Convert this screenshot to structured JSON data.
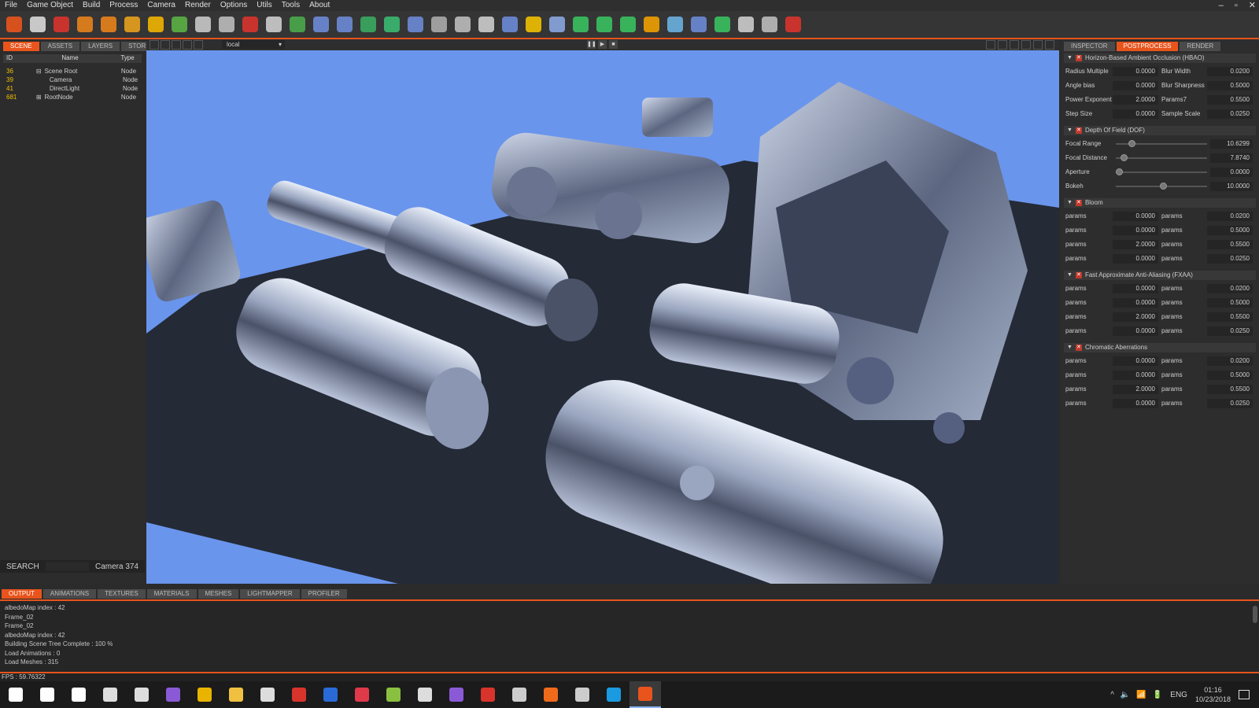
{
  "menu": [
    "File",
    "Game Object",
    "Build",
    "Process",
    "Camera",
    "Render",
    "Options",
    "Utils",
    "Tools",
    "About"
  ],
  "window_controls": [
    "–",
    "▫",
    "✕"
  ],
  "toolbar_icons": [
    {
      "name": "character-icon",
      "color": "#e8541c"
    },
    {
      "name": "trooper-helmet-icon",
      "color": "#d8d8d8"
    },
    {
      "name": "trash-icon",
      "color": "#d8342c"
    },
    {
      "name": "box-icon",
      "color": "#e8821c"
    },
    {
      "name": "rotate-icon",
      "color": "#e8821c"
    },
    {
      "name": "move-icon",
      "color": "#e8a01c"
    },
    {
      "name": "gamepad-icon",
      "color": "#f0b400"
    },
    {
      "name": "terrain-icon",
      "color": "#5ab044"
    },
    {
      "name": "particles-icon",
      "color": "#c8c8c8"
    },
    {
      "name": "cube-gray-icon",
      "color": "#bbbbbb"
    },
    {
      "name": "octopus-icon",
      "color": "#d8342c"
    },
    {
      "name": "igs-text-icon",
      "color": "#cccccc"
    },
    {
      "name": "igs-map-icon",
      "color": "#4aa84a"
    },
    {
      "name": "leaf-icon",
      "color": "#6b8ad6"
    },
    {
      "name": "cube-blue-icon",
      "color": "#6b8ad6"
    },
    {
      "name": "map-green-icon",
      "color": "#3aa860"
    },
    {
      "name": "sphere-icon",
      "color": "#3ab870"
    },
    {
      "name": "arrow-up-icon",
      "color": "#6b8ad6"
    },
    {
      "name": "grid-cube-icon",
      "color": "#aaaaaa"
    },
    {
      "name": "dots-grid-icon",
      "color": "#bbbbbb"
    },
    {
      "name": "hex-icon",
      "color": "#cccccc"
    },
    {
      "name": "eye-icon",
      "color": "#6b8ad6"
    },
    {
      "name": "terminal-icon",
      "color": "#f0c000"
    },
    {
      "name": "feather-icon",
      "color": "#8aa6e0"
    },
    {
      "name": "link-icon",
      "color": "#3ac060"
    },
    {
      "name": "leaf-green-icon",
      "color": "#3ac060"
    },
    {
      "name": "fern-icon",
      "color": "#3ac060"
    },
    {
      "name": "eye-orange-icon",
      "color": "#f0a000"
    },
    {
      "name": "gem-icon",
      "color": "#6ab0e0"
    },
    {
      "name": "mountain-icon",
      "color": "#6b8ad6"
    },
    {
      "name": "chip-icon",
      "color": "#3ac060"
    },
    {
      "name": "molecule-icon",
      "color": "#cccccc"
    },
    {
      "name": "brain-icon",
      "color": "#bbbbbb"
    },
    {
      "name": "close-circle-icon",
      "color": "#d8342c"
    }
  ],
  "left_tabs": [
    "SCENE",
    "ASSETS",
    "LAYERS",
    "STORE"
  ],
  "scene_columns": [
    "ID",
    "Name",
    "Type"
  ],
  "scene_rows": [
    {
      "id": "36",
      "expander": "⊟",
      "name": "Scene Root",
      "type": "Node"
    },
    {
      "id": "39",
      "expander": "",
      "name": "Camera",
      "type": "Node"
    },
    {
      "id": "41",
      "expander": "",
      "name": "DirectLight",
      "type": "Node"
    },
    {
      "id": "681",
      "expander": "⊞",
      "name": "RootNode",
      "type": "Node"
    }
  ],
  "search": {
    "label": "SEARCH",
    "camera": "Camera 374"
  },
  "viewport": {
    "space": "local",
    "controls": [
      "❚❚",
      "▶",
      "■"
    ]
  },
  "right_tabs": [
    "INSPECTOR",
    "POSTPROCESS",
    "RENDER"
  ],
  "postprocess": {
    "hbao": {
      "title": "Horizon-Based Ambient Occlusion (HBAO)",
      "rows": [
        {
          "l1": "Radius Multiple",
          "v1": "0.0000",
          "l2": "Blur Width",
          "v2": "0.0200"
        },
        {
          "l1": "Angle bias",
          "v1": "0.0000",
          "l2": "Blur Sharpness",
          "v2": "0.5000"
        },
        {
          "l1": "Power Exponent",
          "v1": "2.0000",
          "l2": "Params7",
          "v2": "0.5500"
        },
        {
          "l1": "Step Size",
          "v1": "0.0000",
          "l2": "Sample Scale",
          "v2": "0.0250"
        }
      ]
    },
    "dof": {
      "title": "Depth Of Field (DOF)",
      "rows": [
        {
          "label": "Focal Range",
          "value": "10.6299",
          "level": 0.14
        },
        {
          "label": "Focal Distance",
          "value": "7.8740",
          "level": 0.05
        },
        {
          "label": "Aperture",
          "value": "0.0000",
          "level": 0.0
        },
        {
          "label": "Bokeh",
          "value": "10.0000",
          "level": 0.5
        }
      ]
    },
    "bloom": {
      "title": "Bloom",
      "rows": [
        {
          "l1": "params",
          "v1": "0.0000",
          "l2": "params",
          "v2": "0.0200"
        },
        {
          "l1": "params",
          "v1": "0.0000",
          "l2": "params",
          "v2": "0.5000"
        },
        {
          "l1": "params",
          "v1": "2.0000",
          "l2": "params",
          "v2": "0.5500"
        },
        {
          "l1": "params",
          "v1": "0.0000",
          "l2": "params",
          "v2": "0.0250"
        }
      ]
    },
    "fxaa": {
      "title": "Fast Approximate Anti-Aliasing (FXAA)",
      "rows": [
        {
          "l1": "params",
          "v1": "0.0000",
          "l2": "params",
          "v2": "0.0200"
        },
        {
          "l1": "params",
          "v1": "0.0000",
          "l2": "params",
          "v2": "0.5000"
        },
        {
          "l1": "params",
          "v1": "2.0000",
          "l2": "params",
          "v2": "0.5500"
        },
        {
          "l1": "params",
          "v1": "0.0000",
          "l2": "params",
          "v2": "0.0250"
        }
      ]
    },
    "chromatic": {
      "title": "Chromatic Aberrations",
      "rows": [
        {
          "l1": "params",
          "v1": "0.0000",
          "l2": "params",
          "v2": "0.0200"
        },
        {
          "l1": "params",
          "v1": "0.0000",
          "l2": "params",
          "v2": "0.5000"
        },
        {
          "l1": "params",
          "v1": "2.0000",
          "l2": "params",
          "v2": "0.5500"
        },
        {
          "l1": "params",
          "v1": "0.0000",
          "l2": "params",
          "v2": "0.0250"
        }
      ]
    }
  },
  "bottom_tabs": [
    "OUTPUT",
    "ANIMATIONS",
    "TEXTURES",
    "MATERIALS",
    "MESHES",
    "LIGHTMAPPER",
    "PROFILER"
  ],
  "output_lines": [
    "albedoMap index : 42",
    "Frame_02",
    "Frame_02",
    "albedoMap index : 42",
    "Building Scene Tree Complete : 100 %",
    "Load Animations : 0",
    "Load Meshes : 315"
  ],
  "status": {
    "fps": "FPS : 59.76322"
  },
  "taskbar": {
    "icons": [
      {
        "name": "windows-start-icon",
        "color": "#ffffff"
      },
      {
        "name": "cortana-icon",
        "color": "#ffffff"
      },
      {
        "name": "mail-icon",
        "color": "#ffffff"
      },
      {
        "name": "calculator-icon",
        "color": "#dddddd"
      },
      {
        "name": "store-icon",
        "color": "#dddddd"
      },
      {
        "name": "app-purple-icon",
        "color": "#8a5ad6"
      },
      {
        "name": "chrome-icon",
        "color": "#e8b400"
      },
      {
        "name": "folder-icon",
        "color": "#f0c040"
      },
      {
        "name": "gmail-icon",
        "color": "#dddddd"
      },
      {
        "name": "game-icon",
        "color": "#d8342c"
      },
      {
        "name": "editor-blue-icon",
        "color": "#2a6ad6"
      },
      {
        "name": "pocket-icon",
        "color": "#e03a4a"
      },
      {
        "name": "notepad-icon",
        "color": "#8ac040"
      },
      {
        "name": "infinity-icon",
        "color": "#dddddd"
      },
      {
        "name": "visual-studio-icon",
        "color": "#8a5ad6"
      },
      {
        "name": "app-red-icon",
        "color": "#d8342c"
      },
      {
        "name": "obs-icon",
        "color": "#cccccc"
      },
      {
        "name": "origin-icon",
        "color": "#f06a1c"
      },
      {
        "name": "steam-icon",
        "color": "#cccccc"
      },
      {
        "name": "skype-icon",
        "color": "#1a9ae0"
      },
      {
        "name": "engine-app-icon",
        "color": "#e8541c"
      }
    ],
    "tray": [
      "^",
      "🔈",
      "📶",
      "🔋"
    ],
    "lang": "ENG",
    "time": "01:16",
    "date": "10/23/2018"
  }
}
